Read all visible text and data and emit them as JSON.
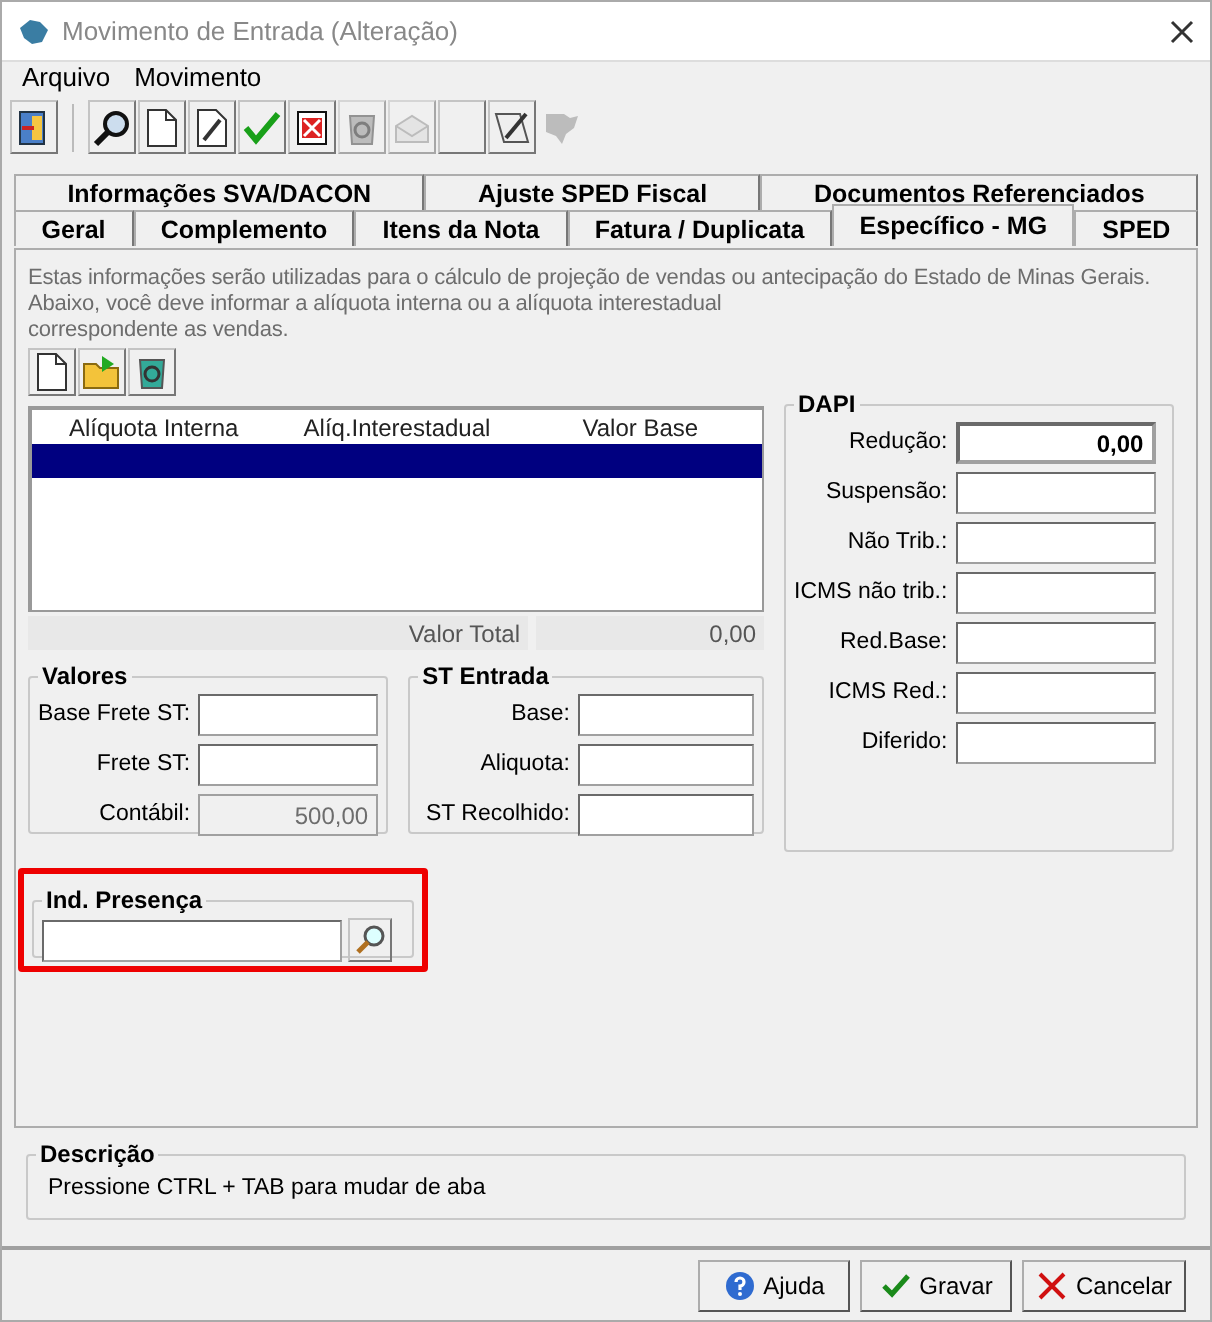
{
  "window": {
    "title": "Movimento de Entrada (Alteração)"
  },
  "menu": [
    "Arquivo",
    "Movimento"
  ],
  "toolbar": [
    {
      "kind": "exit",
      "disabled": false
    },
    {
      "kind": "sep"
    },
    {
      "kind": "search",
      "disabled": false
    },
    {
      "kind": "new",
      "disabled": false
    },
    {
      "kind": "edit",
      "disabled": false
    },
    {
      "kind": "confirm",
      "disabled": false
    },
    {
      "kind": "delete",
      "disabled": false
    },
    {
      "kind": "refresh",
      "disabled": true
    },
    {
      "kind": "mail",
      "disabled": true
    },
    {
      "kind": "blank",
      "disabled": false
    },
    {
      "kind": "iss",
      "disabled": false
    },
    {
      "kind": "map",
      "disabled": true
    }
  ],
  "tab_rows": [
    [
      {
        "label": "Informações SVA/DACON",
        "selected": false
      },
      {
        "label": "Ajuste SPED Fiscal",
        "selected": false
      },
      {
        "label": "Documentos Referenciados",
        "selected": false
      }
    ],
    [
      {
        "label": "Geral",
        "selected": false
      },
      {
        "label": "Complemento",
        "selected": false
      },
      {
        "label": "Itens da Nota",
        "selected": false
      },
      {
        "label": "Fatura / Duplicata",
        "selected": false
      },
      {
        "label": "Específico - MG",
        "selected": true
      },
      {
        "label": "SPED",
        "selected": false
      }
    ]
  ],
  "intro": [
    "Estas informações serão utilizadas para o cálculo de projeção de vendas ou antecipação do Estado de Minas Gerais.",
    "Abaixo, você deve informar a alíquota interna ou a alíquota interestadual",
    "correspondente as vendas."
  ],
  "grid_tools": [
    {
      "kind": "new"
    },
    {
      "kind": "open"
    },
    {
      "kind": "refresh"
    }
  ],
  "grid": {
    "columns": [
      "Alíquota Interna",
      "Alíq.Interestadual",
      "Valor Base"
    ],
    "rows": [
      {
        "selected": true
      }
    ],
    "total_label": "Valor Total",
    "total": "0,00"
  },
  "valores": {
    "title": "Valores",
    "fields": [
      {
        "label": "Base Frete ST:",
        "disabled": false
      },
      {
        "label": "Frete ST:",
        "disabled": false
      },
      {
        "label": "Contábil:",
        "value": "500,00",
        "disabled": true
      }
    ]
  },
  "st_entrada": {
    "title": "ST Entrada",
    "fields": [
      {
        "label": "Base:"
      },
      {
        "label": "Aliquota:"
      },
      {
        "label": "ST Recolhido:"
      }
    ]
  },
  "dapi": {
    "title": "DAPI",
    "fields": [
      {
        "label": "Redução:",
        "value": "0,00",
        "focused": true
      },
      {
        "label": "Suspensão:",
        "focused": false
      },
      {
        "label": "Não Trib.:",
        "focused": false
      },
      {
        "label": "ICMS não trib.:",
        "focused": false
      },
      {
        "label": "Red.Base:",
        "focused": false
      },
      {
        "label": "ICMS Red.:",
        "focused": false
      },
      {
        "label": "Diferido:",
        "focused": false
      }
    ]
  },
  "ind_presenca": {
    "title": "Ind. Presença",
    "highlighted": true
  },
  "descricao": {
    "title": "Descrição",
    "text": "Pressione CTRL + TAB para  mudar de aba"
  },
  "buttons": [
    {
      "kind": "help",
      "label": "Ajuda"
    },
    {
      "kind": "save",
      "label": "Gravar"
    },
    {
      "kind": "cancel",
      "label": "Cancelar"
    }
  ]
}
